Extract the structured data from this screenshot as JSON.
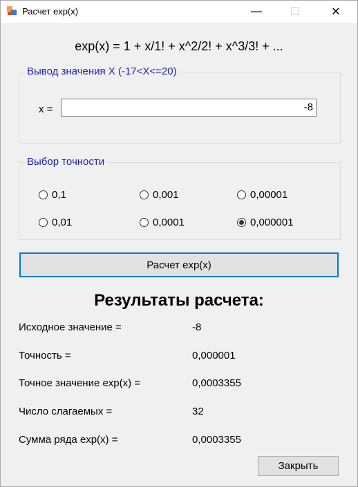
{
  "window": {
    "title": "Расчет exp(x)",
    "minimize_glyph": "—",
    "maximize_glyph": "☐",
    "close_glyph": "✕"
  },
  "formula": "exp(x) = 1 + x/1! + x^2/2! + x^3/3! + ...",
  "input_group": {
    "title": "Вывод значения X (-17<X<=20)",
    "x_label": "x =",
    "x_value": "-8"
  },
  "precision_group": {
    "title": "Выбор точности",
    "options": [
      {
        "label": "0,1",
        "selected": false
      },
      {
        "label": "0,001",
        "selected": false
      },
      {
        "label": "0,00001",
        "selected": false
      },
      {
        "label": "0,01",
        "selected": false
      },
      {
        "label": "0,0001",
        "selected": false
      },
      {
        "label": "0,000001",
        "selected": true
      }
    ]
  },
  "calc_button": "Расчет exp(x)",
  "results": {
    "title": "Результаты расчета:",
    "rows": [
      {
        "label": "Исходное значение =",
        "value": "-8"
      },
      {
        "label": "Точность =",
        "value": "0,000001"
      },
      {
        "label": "Точное значение exp(x) =",
        "value": "0,0003355"
      },
      {
        "label": "Число слагаемых =",
        "value": "32"
      },
      {
        "label": "Сумма ряда exp(x) =",
        "value": "0,0003355"
      }
    ]
  },
  "close_button": "Закрыть"
}
